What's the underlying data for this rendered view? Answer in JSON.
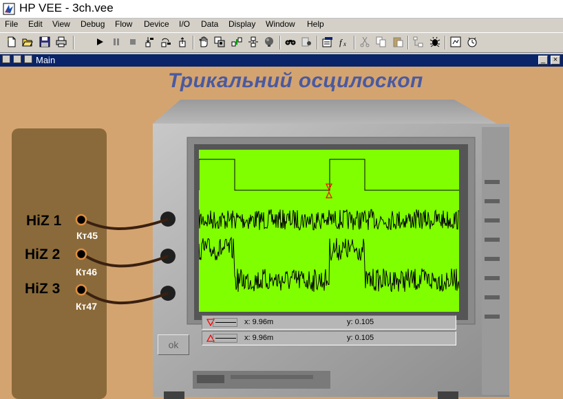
{
  "window": {
    "title": "HP VEE - 3ch.vee"
  },
  "menu": [
    "File",
    "Edit",
    "View",
    "Debug",
    "Flow",
    "Device",
    "I/O",
    "Data",
    "Display",
    "Window",
    "Help"
  ],
  "toolbar": {
    "icons": [
      "new-icon",
      "open-icon",
      "save-icon",
      "print-icon",
      "run-icon",
      "pause-icon",
      "stop-icon",
      "step-into-icon",
      "step-over-icon",
      "step-out-icon",
      "hand-icon",
      "copy-object-icon",
      "show-data-flow-icon",
      "show-execution-flow-icon",
      "bulb-icon",
      "find-icon",
      "binoculars-icon",
      "properties-icon",
      "function-icon",
      "cut-icon",
      "copy-icon",
      "paste-icon",
      "align-icon",
      "debug-icon",
      "panel-icon",
      "timer-icon"
    ]
  },
  "main_window": {
    "title": "Main",
    "minimize_label": "_",
    "close_label": "×"
  },
  "panel": {
    "heading": "Трикальний осцилоскоп",
    "channels": [
      {
        "label": "HiZ 1",
        "test_point": "Кт45"
      },
      {
        "label": "HiZ 2",
        "test_point": "Кт46"
      },
      {
        "label": "HiZ 3",
        "test_point": "Кт47"
      }
    ],
    "ok_label": "ok",
    "markers": [
      {
        "x_text": "x: 9.96m",
        "y_text": "y: 0.105",
        "color": "#ff0000"
      },
      {
        "x_text": "x: 9.96m",
        "y_text": "y: 0.105",
        "color": "#ff0000"
      }
    ]
  },
  "colors": {
    "screen": "#80ff00",
    "trace": "#000000",
    "heading": "#4a5aa0",
    "background": "#d4a470",
    "probe_panel": "#8a6a3a"
  }
}
